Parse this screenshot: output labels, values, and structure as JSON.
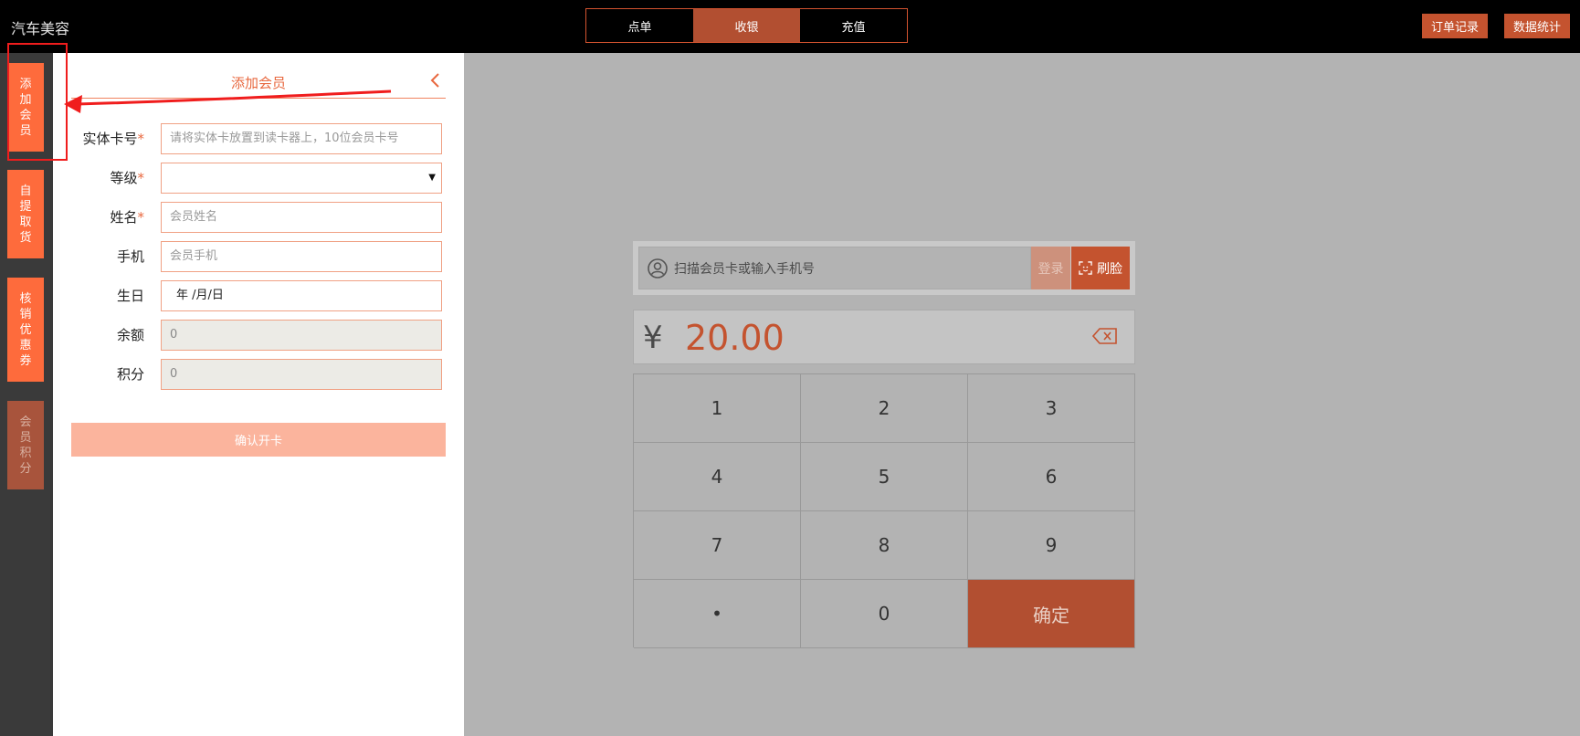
{
  "app": {
    "title": "汽车美容"
  },
  "top_tabs": [
    {
      "label": "点单",
      "active": false
    },
    {
      "label": "收银",
      "active": true
    },
    {
      "label": "充值",
      "active": false
    }
  ],
  "top_buttons": {
    "orders": "订单记录",
    "stats": "数据统计"
  },
  "rail": [
    {
      "chars": [
        "添",
        "加",
        "会",
        "员"
      ],
      "active": true
    },
    {
      "chars": [
        "自",
        "提",
        "取",
        "货"
      ],
      "active": true
    },
    {
      "chars": [
        "核",
        "销",
        "优",
        "惠",
        "券"
      ],
      "active": true
    },
    {
      "chars": [
        "会",
        "员",
        "积",
        "分"
      ],
      "active": false
    }
  ],
  "panel": {
    "title": "添加会员",
    "fields": {
      "card": {
        "label": "实体卡号",
        "required": "*",
        "placeholder": "请将实体卡放置到读卡器上，10位会员卡号"
      },
      "level": {
        "label": "等级",
        "required": "*",
        "value": "",
        "caret": "▼"
      },
      "name": {
        "label": "姓名",
        "required": "*",
        "placeholder": "会员姓名"
      },
      "phone": {
        "label": "手机",
        "placeholder": "会员手机"
      },
      "birthday": {
        "label": "生日",
        "value": "年 /月/日"
      },
      "balance": {
        "label": "余额",
        "value": "0"
      },
      "points": {
        "label": "积分",
        "value": "0"
      }
    },
    "confirm_label": "确认开卡"
  },
  "pos": {
    "member_placeholder": "扫描会员卡或输入手机号",
    "login_label": "登录",
    "face_label": "刷脸",
    "currency": "¥",
    "amount": "20.00",
    "keys": [
      "1",
      "2",
      "3",
      "4",
      "5",
      "6",
      "7",
      "8",
      "9",
      "•",
      "0"
    ],
    "confirm_label": "确定"
  },
  "colors": {
    "accent": "#c4532f",
    "accent_light": "#fe6b3c",
    "annotation": "#f01d1d"
  }
}
